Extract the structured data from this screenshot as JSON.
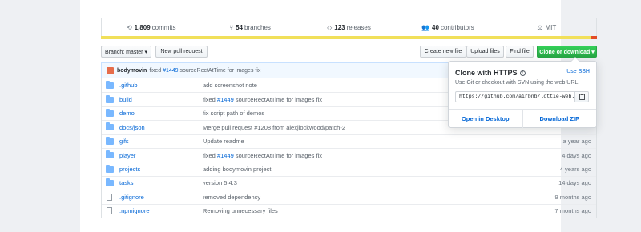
{
  "stats": {
    "commits_count": "1,809",
    "commits_label": "commits",
    "branches_count": "54",
    "branches_label": "branches",
    "releases_count": "123",
    "releases_label": "releases",
    "contributors_count": "40",
    "contributors_label": "contributors",
    "license": "MIT"
  },
  "toolbar": {
    "branch_label": "Branch: master ▾",
    "new_pr": "New pull request",
    "create_file": "Create new file",
    "upload_files": "Upload files",
    "find_file": "Find file",
    "clone_download": "Clone or download ▾"
  },
  "commit": {
    "author": "bodymovin",
    "prefix": "fixed",
    "issue": "#1449",
    "message": "sourceRectAtTime for images fix"
  },
  "files": [
    {
      "type": "folder",
      "name": ".github",
      "msg": "add screenshot note",
      "issue": "",
      "msg2": "",
      "age": ""
    },
    {
      "type": "folder",
      "name": "build",
      "msg": "fixed",
      "issue": "#1449",
      "msg2": "sourceRectAtTime for images fix",
      "age": ""
    },
    {
      "type": "folder",
      "name": "demo",
      "msg": "fix script path of demos",
      "issue": "",
      "msg2": "",
      "age": ""
    },
    {
      "type": "folder",
      "name": "docs/json",
      "msg": "Merge pull request #1208 from alexjlockwood/patch-2",
      "issue": "",
      "msg2": "",
      "age": ""
    },
    {
      "type": "folder",
      "name": "gifs",
      "msg": "Update readme",
      "issue": "",
      "msg2": "",
      "age": "a year ago"
    },
    {
      "type": "folder",
      "name": "player",
      "msg": "fixed",
      "issue": "#1449",
      "msg2": "sourceRectAtTime for images fix",
      "age": "4 days ago"
    },
    {
      "type": "folder",
      "name": "projects",
      "msg": "adding bodymovin project",
      "issue": "",
      "msg2": "",
      "age": "4 years ago"
    },
    {
      "type": "folder",
      "name": "tasks",
      "msg": "version 5.4.3",
      "issue": "",
      "msg2": "",
      "age": "14 days ago"
    },
    {
      "type": "file",
      "name": ".gitignore",
      "msg": "removed dependency",
      "issue": "",
      "msg2": "",
      "age": "9 months ago"
    },
    {
      "type": "file",
      "name": ".npmignore",
      "msg": "Removing unnecessary files",
      "issue": "",
      "msg2": "",
      "age": "7 months ago"
    }
  ],
  "clone": {
    "title": "Clone with HTTPS",
    "help_icon": "question-icon",
    "use_ssh": "Use SSH",
    "desc": "Use Git or checkout with SVN using the web URL.",
    "url": "https://github.com/airbnb/lottie-web.",
    "copy_icon": "clipboard-icon",
    "open_desktop": "Open in Desktop",
    "download_zip": "Download ZIP"
  },
  "colors": {
    "lang_primary": "#f1e05a",
    "lang_secondary": "#e34c26",
    "accent": "#28a745",
    "link": "#0366d6"
  }
}
